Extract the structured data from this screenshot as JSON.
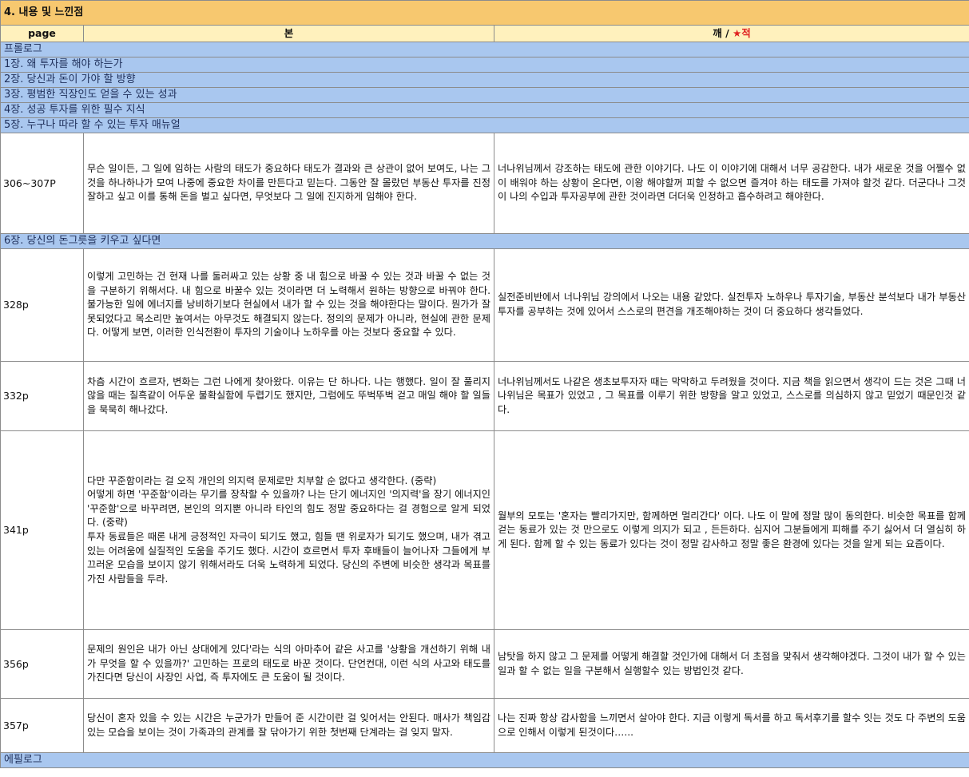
{
  "section_title": "4. 내용 및 느낀점",
  "headers": {
    "page": "page",
    "main": "본",
    "note_prefix": "깨 / ",
    "note_star": "★",
    "note_suffix": "적"
  },
  "chapters": {
    "prologue": "프롤로그",
    "ch1": "1장. 왜 투자를 해야 하는가",
    "ch2": "2장. 당신과 돈이 가야 할 방향",
    "ch3": "3장. 평범한 직장인도 얻을 수 있는 성과",
    "ch4": "4장. 성공 투자를 위한 필수 지식",
    "ch5": "5장. 누구나 따라 할 수 있는 투자 매뉴얼",
    "ch6": "6장. 당신의 돈그릇을 키우고 싶다면",
    "epilogue": "에필로그"
  },
  "rows": [
    {
      "page": "306~307P",
      "body": "무슨 일이든, 그 일에 임하는 사람의 태도가 중요하다 태도가 결과와 큰 상관이 없어 보여도, 나는 그것을 하나하나가 모여 나중에 중요한 차이를 만든다고 믿는다. 그동안 잘 몰랐던 부동산 투자를 진정 잘하고 싶고 이를 통해 돈을 벌고 싶다면, 무엇보다 그 일에 진지하게 임해야 한다.",
      "note": "너나위님께서 강조하는 태도에 관한 이야기다. 나도 이 이야기에 대해서 너무 공감한다. 내가 새로운 것을 어쩔수 없이 배워야 하는 상황이 온다면, 이왕 해야할꺼 피할 수 없으면 즐겨야 하는 태도를 가져야 할것 같다. 더군다나 그것이 나의 수입과 투자공부에 관한 것이라면 더더욱 인정하고 흡수하려고 해야한다."
    },
    {
      "page": "328p",
      "body": "이렇게 고민하는 건 현재 나를 둘러싸고 있는 상황 중 내 힘으로 바꿀 수 있는 것과 바꿀 수 없는 것을 구분하기 위해서다. 내 힘으로 바꿀수 있는 것이라면 더 노력해서 원하는 방향으로 바꿔야 한다. 불가능한 일에 에너지를 낭비하기보다 현실에서 내가 할 수 있는 것을 해야한다는 말이다. 뭔가가 잘못되었다고 목소리만 높여서는 아무것도 해결되지 않는다. 정의의 문제가 아니라, 현실에 관한 문제다. 어떻게 보면, 이러한 인식전환이 투자의 기술이나 노하우를 아는 것보다 중요할 수 있다.",
      "note": "실전준비반에서 너나위님 강의에서 나오는 내용 같았다. 실전투자 노하우나 투자기술, 부동산 분석보다 내가 부동산 투자를 공부하는 것에 있어서 스스로의 편견을 개조해야하는 것이 더 중요하다 생각들었다."
    },
    {
      "page": "332p",
      "body": "차츰 시간이 흐르자, 변화는 그런 나에게 찾아왔다. 이유는 단 하나다. 나는 행했다. 일이 잘 풀리지 않을 때는 칠흑같이 어두운 불확실함에 두렵기도 했지만, 그럼에도 뚜벅뚜벅 걷고 매일 해야 할 일들을 묵묵히 해나갔다.",
      "note": "너나위님께서도 나같은 생초보투자자 때는 막막하고 두려웠을 것이다. 지금 책을 읽으면서 생각이 드는 것은 그때 너나위님은 목표가 있었고 , 그 목표를 이루기 위한 방향을 알고 있었고, 스스로를 의심하지 않고 믿었기 때문인것 같다."
    },
    {
      "page": "341p",
      "body1": "다만 꾸준함이라는 걸 오직 개인의 의지력 문제로만 치부할 순 없다고 생각한다. (중략)",
      "body2": "어떻게 하면 '꾸준함'이라는 무기를 장착할 수 있을까? 나는 단기 에너지인 '의지력'을 장기 에너지인 '꾸준함'으로 바꾸려면, 본인의 의지뿐 아니라 타인의 힘도 정말 중요하다는 걸 경험으로 알게 되었다. (중략)",
      "body3": "투자 동료들은 때론 내게 긍정적인 자극이 되기도 했고, 힘들 땐 위로자가 되기도 했으며, 내가 겪고 있는 어려움에 실질적인 도움을 주기도 했다. 시간이 흐르면서 투자 후배들이 늘어나자 그들에게 부끄러운 모습을 보이지 않기 위해서라도 더욱 노력하게 되었다. 당신의 주변에 비슷한 생각과 목표를 가진 사람들을 두라.",
      "note": "월부의 모토는 '혼자는 빨리가지만, 함께하면 멀리간다' 이다. 나도 이 말에 정말 많이 동의한다. 비슷한 목표를 함께 걷는 동료가 있는 것 만으로도 이렇게 의지가 되고 , 든든하다. 심지어 그분들에게 피해를 주기 싫어서 더 열심히 하게 된다. 함께 할 수 있는 동료가 있다는 것이 정말 감사하고 정말 좋은 환경에 있다는 것을 알게 되는 요즘이다."
    },
    {
      "page": "356p",
      "body": "문제의 원인은 내가 아닌 상대에게 있다'라는 식의 아마추어 같은 사고를 '상황을 개선하기 위해 내가 무엇을 할 수 있을까?' 고민하는 프로의 태도로 바꾼 것이다. 단언컨대, 이런 식의 사고와 태도를 가진다면 당신이 사장인 사업, 즉 투자에도 큰 도움이 될 것이다.",
      "note": "남탓을 하지 않고 그 문제를 어떻게 해결할 것인가에 대해서 더 초점을 맞춰서 생각해야겠다. 그것이 내가 할 수 있는 일과 할 수 없는 일을 구분해서 실행할수 있는 방법인것 같다."
    },
    {
      "page": "357p",
      "body": "당신이 혼자 있을 수 있는 시간은 누군가가 만들어 준 시간이란 걸 잊어서는 안된다. 매사가 책임감 있는 모습을 보이는 것이 가족과의 관계를 잘 닦아가기 위한 첫번째 단계라는 걸 잊지 말자.",
      "note": "나는 진짜 항상 감사함을 느끼면서 살아야 한다. 지금 이렇게 독서를 하고 독서후기를 할수 잇는 것도 다 주변의 도움으로 인해서 이렇게 된것이다…..."
    }
  ]
}
